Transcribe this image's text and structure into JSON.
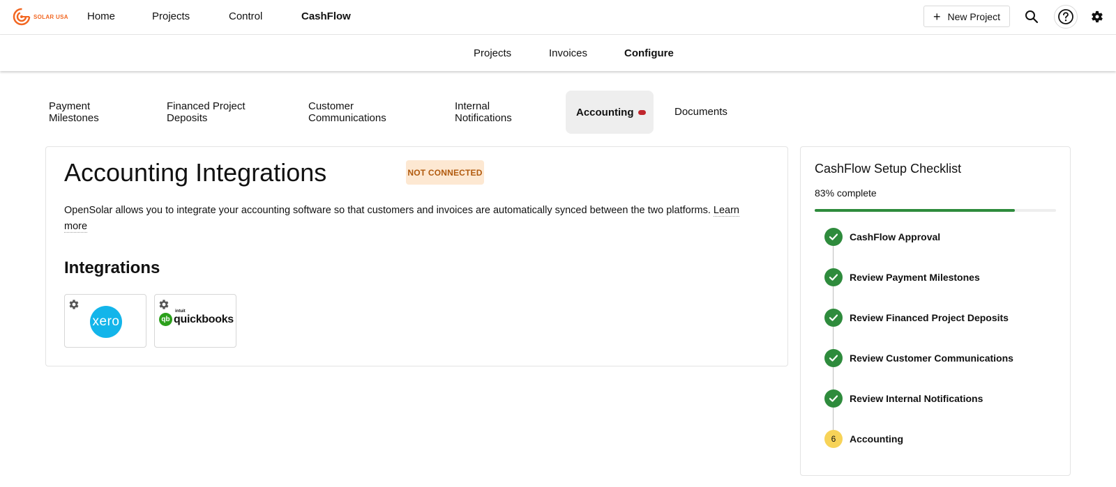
{
  "brand": {
    "logo_text": "SOLAR USA",
    "accent": "#f26722"
  },
  "topnav": {
    "links": [
      "Home",
      "Projects",
      "Control",
      "CashFlow"
    ],
    "active": "CashFlow",
    "new_project_label": "New Project"
  },
  "subnav": {
    "links": [
      "Projects",
      "Invoices",
      "Configure"
    ],
    "active": "Configure"
  },
  "tabs": {
    "items": [
      {
        "line1": "Payment",
        "line2": "Milestones"
      },
      {
        "line1": "Financed Project",
        "line2": "Deposits"
      },
      {
        "line1": "Customer",
        "line2": "Communications"
      },
      {
        "line1": "Internal",
        "line2": "Notifications"
      },
      {
        "line1": "Accounting",
        "line2": ""
      },
      {
        "line1": "Documents",
        "line2": ""
      }
    ],
    "active": "Accounting"
  },
  "main": {
    "title": "Accounting Integrations",
    "status_badge": "NOT CONNECTED",
    "description": "OpenSolar allows you to integrate your accounting software so that customers and invoices are automatically synced between the two platforms.",
    "learn_more": "Learn more",
    "integrations_title": "Integrations",
    "integrations": [
      {
        "name": "xero",
        "logo_text": "xero",
        "color": "#13b5ea"
      },
      {
        "name": "quickbooks",
        "logo_text": "quickbooks",
        "mark": "qb",
        "small_text": "intuit",
        "color": "#2ca01c"
      }
    ]
  },
  "checklist": {
    "title": "CashFlow Setup Checklist",
    "percent_label": "83% complete",
    "progress": 0.83,
    "steps": [
      {
        "label": "CashFlow Approval",
        "status": "done"
      },
      {
        "label": "Review Payment Milestones",
        "status": "done"
      },
      {
        "label": "Review Financed Project Deposits",
        "status": "done"
      },
      {
        "label": "Review Customer Communications",
        "status": "done"
      },
      {
        "label": "Review Internal Notifications",
        "status": "done"
      },
      {
        "label": "Accounting",
        "status": "current",
        "number": "6"
      }
    ],
    "colors": {
      "done": "#2e8b3c",
      "current": "#f7d358"
    }
  }
}
